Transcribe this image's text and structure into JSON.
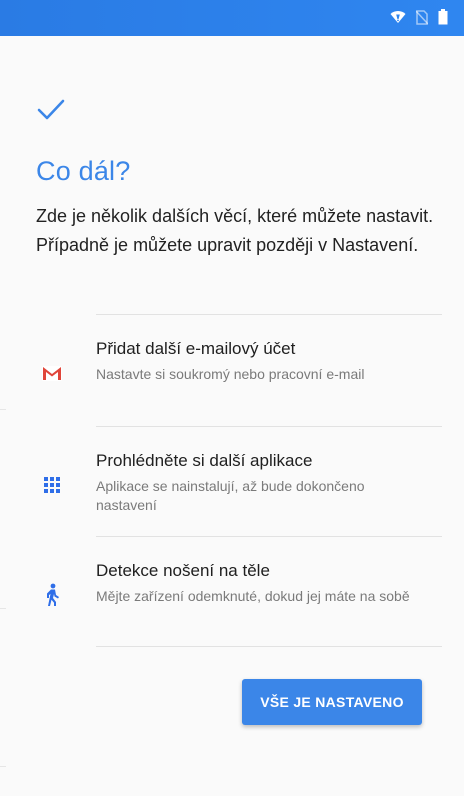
{
  "status_bar": {
    "color": "#2f86f0",
    "icons": [
      "wifi-icon",
      "no-sim-icon",
      "battery-icon"
    ]
  },
  "setup": {
    "check_icon": "checkmark-icon",
    "title": "Co dál?",
    "description": "Zde je několik dalších věcí, které můžete nastavit. Případně je můžete upravit později v Nastavení.",
    "items": [
      {
        "icon": "gmail-icon",
        "title": "Přidat další e-mailový účet",
        "subtitle": "Nastavte si soukromý nebo pracovní e-mail"
      },
      {
        "icon": "apps-grid-icon",
        "title": "Prohlédněte si další aplikace",
        "subtitle": "Aplikace se nainstalují, až bude dokončeno nastavení"
      },
      {
        "icon": "walking-person-icon",
        "title": "Detekce nošení na těle",
        "subtitle": "Mějte zařízení odemknuté, dokud jej máte na sobě"
      }
    ],
    "done_button": "VŠE JE NASTAVENO"
  },
  "colors": {
    "accent": "#3b86e8",
    "background": "#fafafa",
    "gmail_red": "#e0453a"
  }
}
